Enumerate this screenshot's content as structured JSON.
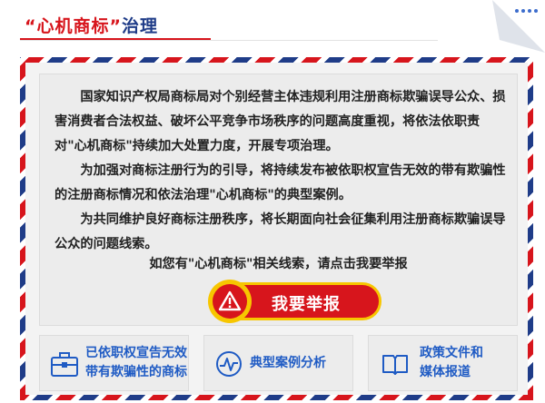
{
  "header": {
    "title_quoted": "“心机商标”",
    "title_suffix": "治理"
  },
  "notice": {
    "paragraph1": "国家知识产权局商标局对个别经营主体违规利用注册商标欺骗误导公众、损害消费者合法权益、破坏公平竞争市场秩序的问题高度重视，将依法依职责对\"心机商标\"持续加大处置力度，开展专项治理。",
    "paragraph2": "为加强对商标注册行为的引导，将持续发布被依职权宣告无效的带有欺骗性的注册商标情况和依法治理\"心机商标\"的典型案例。",
    "paragraph3": "为共同维护良好商标注册秩序，将长期面向社会征集利用注册商标欺骗误导公众的问题线索。",
    "cta": "如您有\"心机商标\"相关线索，请点击我要举报"
  },
  "report_button": {
    "label": "我要举报"
  },
  "cards": [
    {
      "line1": "已依职权宣告无效",
      "line2": "带有欺骗性的商标"
    },
    {
      "line1": "典型案例分析"
    },
    {
      "line1": "政策文件和",
      "line2": "媒体报道"
    }
  ],
  "colors": {
    "red": "#d7151c",
    "blue": "#1f3c88",
    "link_blue": "#1f5bc4",
    "yellow": "#f7c600"
  }
}
